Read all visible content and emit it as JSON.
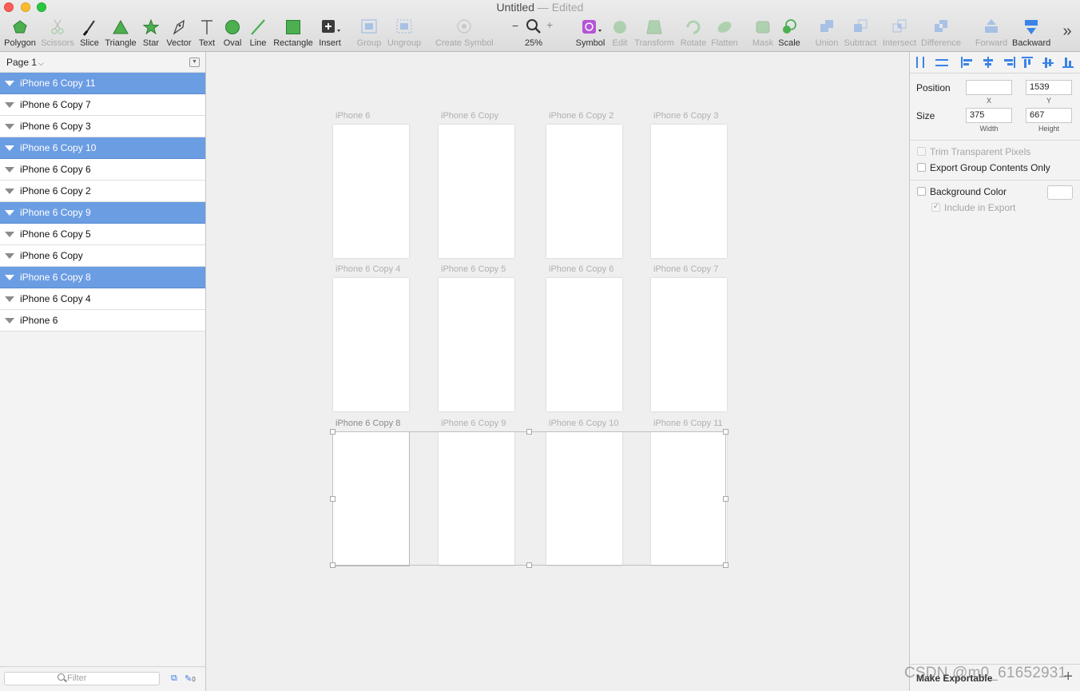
{
  "window": {
    "title": "Untitled",
    "status": "— Edited"
  },
  "toolbar": [
    {
      "label": "Polygon",
      "icon": "polygon-icon",
      "enabled": true
    },
    {
      "label": "Scissors",
      "icon": "scissors-icon",
      "enabled": false
    },
    {
      "label": "Slice",
      "icon": "slice-knife-icon",
      "enabled": true
    },
    {
      "label": "Triangle",
      "icon": "triangle-icon",
      "enabled": true
    },
    {
      "label": "Star",
      "icon": "star-icon",
      "enabled": true
    },
    {
      "label": "Vector",
      "icon": "pen-nib-icon",
      "enabled": true
    },
    {
      "label": "Text",
      "icon": "text-t-icon",
      "enabled": true
    },
    {
      "label": "Oval",
      "icon": "oval-icon",
      "enabled": true
    },
    {
      "label": "Line",
      "icon": "line-icon",
      "enabled": true
    },
    {
      "label": "Rectangle",
      "icon": "rectangle-icon",
      "enabled": true
    },
    {
      "label": "Insert",
      "icon": "insert-plus-icon",
      "enabled": true
    },
    {
      "label": "Group",
      "icon": "group-icon",
      "enabled": false
    },
    {
      "label": "Ungroup",
      "icon": "ungroup-icon",
      "enabled": false
    },
    {
      "label": "Create Symbol",
      "icon": "create-symbol-icon",
      "enabled": false
    },
    {
      "label": "25%",
      "icon": "zoom-magnifier-icon",
      "enabled": true
    },
    {
      "label": "Symbol",
      "icon": "symbol-icon",
      "enabled": true
    },
    {
      "label": "Edit",
      "icon": "edit-icon",
      "enabled": false
    },
    {
      "label": "Transform",
      "icon": "transform-icon",
      "enabled": false
    },
    {
      "label": "Rotate",
      "icon": "rotate-icon",
      "enabled": false
    },
    {
      "label": "Flatten",
      "icon": "flatten-icon",
      "enabled": false
    },
    {
      "label": "Mask",
      "icon": "mask-icon",
      "enabled": false
    },
    {
      "label": "Scale",
      "icon": "scale-icon",
      "enabled": true
    },
    {
      "label": "Union",
      "icon": "union-icon",
      "enabled": false
    },
    {
      "label": "Subtract",
      "icon": "subtract-icon",
      "enabled": false
    },
    {
      "label": "Intersect",
      "icon": "intersect-icon",
      "enabled": false
    },
    {
      "label": "Difference",
      "icon": "difference-icon",
      "enabled": false
    },
    {
      "label": "Forward",
      "icon": "forward-icon",
      "enabled": false
    },
    {
      "label": "Backward",
      "icon": "backward-icon",
      "enabled": true
    }
  ],
  "zoom": {
    "minus": "−",
    "plus": "+",
    "value": "25%"
  },
  "overflow": "»",
  "layers_panel": {
    "page": "Page 1",
    "layers": [
      {
        "name": "iPhone 6 Copy 11",
        "selected": true
      },
      {
        "name": "iPhone 6 Copy 7",
        "selected": false
      },
      {
        "name": "iPhone 6 Copy 3",
        "selected": false
      },
      {
        "name": "iPhone 6 Copy 10",
        "selected": true
      },
      {
        "name": "iPhone 6 Copy 6",
        "selected": false
      },
      {
        "name": "iPhone 6 Copy 2",
        "selected": false
      },
      {
        "name": "iPhone 6 Copy 9",
        "selected": true
      },
      {
        "name": "iPhone 6 Copy 5",
        "selected": false
      },
      {
        "name": "iPhone 6 Copy",
        "selected": false
      },
      {
        "name": "iPhone 6 Copy 8",
        "selected": true
      },
      {
        "name": "iPhone 6 Copy 4",
        "selected": false
      },
      {
        "name": "iPhone 6",
        "selected": false
      }
    ],
    "filter_placeholder": "Filter",
    "filter_badge": "0"
  },
  "canvas": {
    "artboards": [
      {
        "name": "iPhone 6",
        "selected": false
      },
      {
        "name": "iPhone 6 Copy",
        "selected": false
      },
      {
        "name": "iPhone 6 Copy 2",
        "selected": false
      },
      {
        "name": "iPhone 6 Copy 3",
        "selected": false
      },
      {
        "name": "iPhone 6 Copy 4",
        "selected": false
      },
      {
        "name": "iPhone 6 Copy 5",
        "selected": false
      },
      {
        "name": "iPhone 6 Copy 6",
        "selected": false
      },
      {
        "name": "iPhone 6 Copy 7",
        "selected": false
      },
      {
        "name": "iPhone 6 Copy 8",
        "selected": true
      },
      {
        "name": "iPhone 6 Copy 9",
        "selected": true
      },
      {
        "name": "iPhone 6 Copy 10",
        "selected": true
      },
      {
        "name": "iPhone 6 Copy 11",
        "selected": true
      }
    ]
  },
  "inspector": {
    "position": {
      "label": "Position",
      "x": "",
      "y": "1539",
      "x_label": "X",
      "y_label": "Y"
    },
    "size": {
      "label": "Size",
      "width": "375",
      "height": "667",
      "width_label": "Width",
      "height_label": "Height"
    },
    "trim": "Trim Transparent Pixels",
    "export_group": "Export Group Contents Only",
    "background": "Background Color",
    "include_export": "Include in Export",
    "make_exportable": "Make Exportable",
    "plus": "+"
  },
  "watermark": "CSDN @m0_61652931",
  "colors": {
    "selection": "#6b9de3",
    "align_blue": "#3a83e8"
  }
}
